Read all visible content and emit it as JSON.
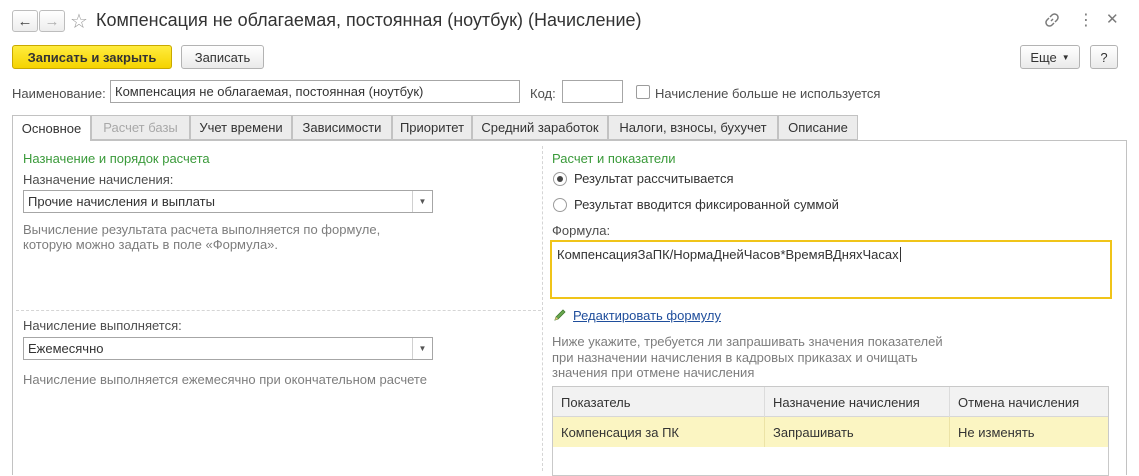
{
  "window": {
    "title": "Компенсация не облагаемая, постоянная (ноутбук) (Начисление)"
  },
  "toolbar": {
    "save_close_label": "Записать и закрыть",
    "save_label": "Записать",
    "more_label": "Еще",
    "help_label": "?"
  },
  "header": {
    "name_label": "Наименование:",
    "name_value": "Компенсация не облагаемая, постоянная (ноутбук)",
    "code_label": "Код:",
    "code_value": "",
    "unused_label": "Начисление больше не используется"
  },
  "tabs": [
    {
      "label": "Основное"
    },
    {
      "label": "Расчет базы"
    },
    {
      "label": "Учет времени"
    },
    {
      "label": "Зависимости"
    },
    {
      "label": "Приоритет"
    },
    {
      "label": "Средний заработок"
    },
    {
      "label": "Налоги, взносы, бухучет"
    },
    {
      "label": "Описание"
    }
  ],
  "left": {
    "section_title": "Назначение и порядок расчета",
    "purpose_label": "Назначение начисления:",
    "purpose_value": "Прочие начисления и выплаты",
    "purpose_hint": "Вычисление результата расчета выполняется по формуле, которую можно задать в поле «Формула».",
    "exec_label": "Начисление выполняется:",
    "exec_value": "Ежемесячно",
    "exec_hint": "Начисление выполняется ежемесячно при окончательном расчете"
  },
  "right": {
    "section_title": "Расчет и показатели",
    "radio_calc": "Результат рассчитывается",
    "radio_fixed": "Результат вводится фиксированной суммой",
    "radio_selected": "calc",
    "formula_label": "Формула:",
    "formula_value": "КомпенсацияЗаПК/НормаДнейЧасов*ВремяВДняхЧасах",
    "edit_formula_link": "Редактировать формулу",
    "indicators_hint": "Ниже укажите, требуется ли запрашивать значения показателей при назначении начисления в кадровых приказах и очищать значения при отмене начисления"
  },
  "table": {
    "columns": [
      "Показатель",
      "Назначение начисления",
      "Отмена начисления"
    ],
    "rows": [
      [
        "Компенсация за ПК",
        "Запрашивать",
        "Не изменять"
      ]
    ]
  },
  "colors": {
    "accent_yellow": "#f5d300",
    "section_green": "#3a9a3a",
    "selected_row": "#fbf5c2",
    "formula_border": "#f0c419",
    "link_blue": "#1f4e9c"
  }
}
